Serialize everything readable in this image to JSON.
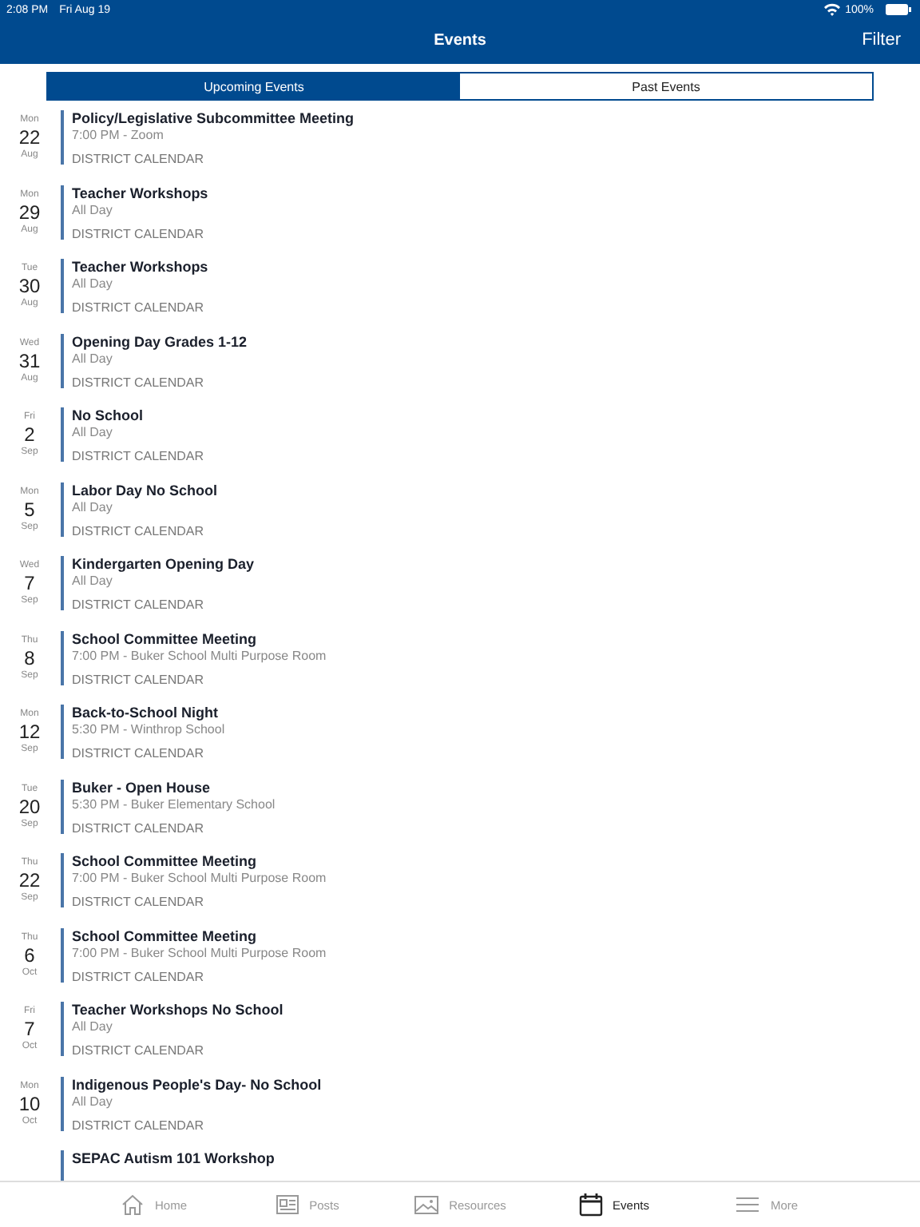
{
  "status_bar": {
    "time": "2:08 PM",
    "date": "Fri Aug 19",
    "battery": "100%"
  },
  "nav_bar": {
    "title": "Events",
    "action": "Filter"
  },
  "segments": [
    {
      "label": "Upcoming Events",
      "selected": true
    },
    {
      "label": "Past Events",
      "selected": false
    }
  ],
  "events": [
    {
      "weekday": "Mon",
      "day": "22",
      "month": "Aug",
      "title": "Policy/Legislative Subcommittee Meeting",
      "details": "7:00 PM - Zoom",
      "calendar": "DISTRICT CALENDAR"
    },
    {
      "weekday": "Mon",
      "day": "29",
      "month": "Aug",
      "title": "Teacher Workshops",
      "details": "All Day",
      "calendar": "DISTRICT CALENDAR"
    },
    {
      "weekday": "Tue",
      "day": "30",
      "month": "Aug",
      "title": "Teacher Workshops",
      "details": "All Day",
      "calendar": "DISTRICT CALENDAR"
    },
    {
      "weekday": "Wed",
      "day": "31",
      "month": "Aug",
      "title": "Opening Day Grades 1-12",
      "details": "All Day",
      "calendar": "DISTRICT CALENDAR"
    },
    {
      "weekday": "Fri",
      "day": "2",
      "month": "Sep",
      "title": "No School",
      "details": "All Day",
      "calendar": "DISTRICT CALENDAR"
    },
    {
      "weekday": "Mon",
      "day": "5",
      "month": "Sep",
      "title": "Labor Day No School",
      "details": "All Day",
      "calendar": "DISTRICT CALENDAR"
    },
    {
      "weekday": "Wed",
      "day": "7",
      "month": "Sep",
      "title": "Kindergarten Opening Day",
      "details": "All Day",
      "calendar": "DISTRICT CALENDAR"
    },
    {
      "weekday": "Thu",
      "day": "8",
      "month": "Sep",
      "title": "School Committee Meeting",
      "details": "7:00 PM - Buker School Multi Purpose Room",
      "calendar": "DISTRICT CALENDAR"
    },
    {
      "weekday": "Mon",
      "day": "12",
      "month": "Sep",
      "title": "Back-to-School Night",
      "details": "5:30 PM - Winthrop School",
      "calendar": "DISTRICT CALENDAR"
    },
    {
      "weekday": "Tue",
      "day": "20",
      "month": "Sep",
      "title": "Buker - Open House",
      "details": "5:30 PM - Buker Elementary School",
      "calendar": "DISTRICT CALENDAR"
    },
    {
      "weekday": "Thu",
      "day": "22",
      "month": "Sep",
      "title": "School Committee Meeting",
      "details": "7:00 PM - Buker School Multi Purpose Room",
      "calendar": "DISTRICT CALENDAR"
    },
    {
      "weekday": "Thu",
      "day": "6",
      "month": "Oct",
      "title": "School Committee Meeting",
      "details": "7:00 PM - Buker School Multi Purpose Room",
      "calendar": "DISTRICT CALENDAR"
    },
    {
      "weekday": "Fri",
      "day": "7",
      "month": "Oct",
      "title": "Teacher Workshops No School",
      "details": "All Day",
      "calendar": "DISTRICT CALENDAR"
    },
    {
      "weekday": "Mon",
      "day": "10",
      "month": "Oct",
      "title": "Indigenous People's Day- No School",
      "details": "All Day",
      "calendar": "DISTRICT CALENDAR"
    },
    {
      "title": "SEPAC Autism 101 Workshop"
    }
  ],
  "tab_bar": [
    {
      "label": "Home",
      "kind": "home",
      "selected": false
    },
    {
      "label": "Posts",
      "kind": "posts",
      "selected": false
    },
    {
      "label": "Resources",
      "kind": "image",
      "selected": false
    },
    {
      "label": "Events",
      "kind": "calendar",
      "selected": true
    },
    {
      "label": "More",
      "kind": "menu",
      "selected": false
    }
  ]
}
